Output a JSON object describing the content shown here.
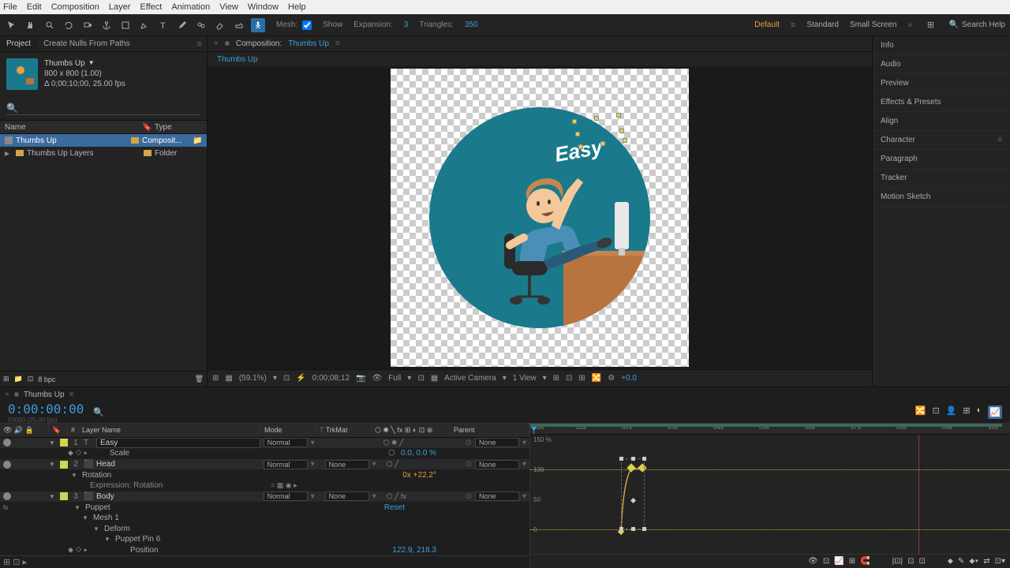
{
  "menubar": [
    "File",
    "Edit",
    "Composition",
    "Layer",
    "Effect",
    "Animation",
    "View",
    "Window",
    "Help"
  ],
  "toolbar": {
    "mesh_label": "Mesh:",
    "show_label": "Show",
    "expansion_label": "Expansion:",
    "expansion_val": "3",
    "triangles_label": "Triangles:",
    "triangles_val": "350"
  },
  "workspaces": {
    "default": "Default",
    "standard": "Standard",
    "small": "Small Screen"
  },
  "search_help": "Search Help",
  "project": {
    "tab_project": "Project",
    "tab_nulls": "Create Nulls From Paths",
    "comp_name": "Thumbs Up",
    "dimensions": "800 x 800 (1.00)",
    "duration": "Δ 0;00;10;00, 25.00 fps",
    "col_name": "Name",
    "col_type": "Type",
    "items": [
      {
        "name": "Thumbs Up",
        "type": "Composit..."
      },
      {
        "name": "Thumbs Up Layers",
        "type": "Folder"
      }
    ],
    "bpc": "8 bpc"
  },
  "composition": {
    "tab_label": "Composition:",
    "name": "Thumbs Up",
    "flowchart": "Thumbs Up",
    "easy": "Easy",
    "footer": {
      "zoom": "(59.1%)",
      "time": "0;00;08;12",
      "full": "Full",
      "camera": "Active Camera",
      "views": "1 View",
      "exposure": "+0.0"
    }
  },
  "right_panels": [
    "Info",
    "Audio",
    "Preview",
    "Effects & Presets",
    "Align",
    "Character",
    "Paragraph",
    "Tracker",
    "Motion Sketch"
  ],
  "timeline": {
    "tab": "Thumbs Up",
    "time": "0:00:00:00",
    "subtime": "00000 (25.00 fps)",
    "cols": {
      "layer_name": "Layer Name",
      "mode": "Mode",
      "trkmat": "TrkMat",
      "parent": "Parent"
    },
    "normal": "Normal",
    "none": "None",
    "layers": [
      {
        "num": "1",
        "name": "Easy"
      },
      {
        "num": "2",
        "name": "Head"
      },
      {
        "num": "3",
        "name": "Body"
      }
    ],
    "props": {
      "scale": "Scale",
      "scale_val": "0.0, 0.0 %",
      "rotation": "Rotation",
      "rotation_val": "0x +22.2°",
      "expr_rotation": "Expression: Rotation",
      "puppet": "Puppet",
      "reset": "Reset",
      "mesh1": "Mesh 1",
      "deform": "Deform",
      "pin6": "Puppet Pin 6",
      "position": "Position",
      "position_val": "122.9, 218.3"
    },
    "ruler": [
      ":00s",
      "01s",
      "02s",
      "03s",
      "04s",
      "05s",
      "06s",
      "07s",
      "08s",
      "09s",
      "10s"
    ],
    "graph_labels": [
      "150 %",
      "100",
      "50",
      "0"
    ]
  }
}
